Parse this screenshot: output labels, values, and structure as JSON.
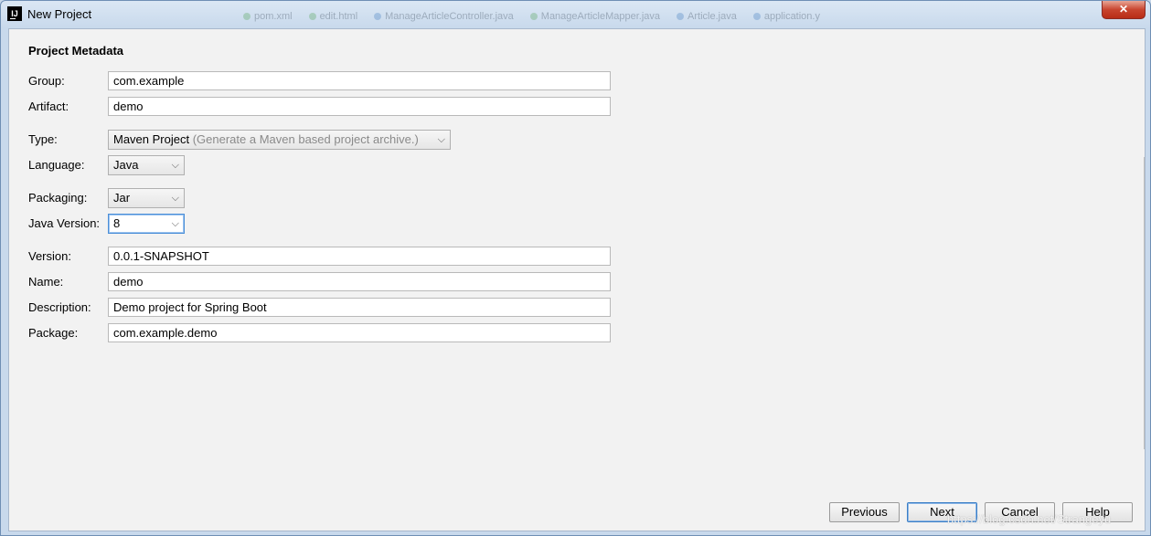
{
  "window": {
    "title": "New Project",
    "app_icon_text": "IJ",
    "close_symbol": "✕",
    "background_tabs": [
      "pom.xml",
      "edit.html",
      "ManageArticleController.java",
      "ManageArticleMapper.java",
      "Article.java",
      "application.y"
    ]
  },
  "section": {
    "title": "Project Metadata"
  },
  "form": {
    "group": {
      "label": "Group:",
      "value": "com.example"
    },
    "artifact": {
      "label": "Artifact:",
      "value": "demo"
    },
    "type": {
      "label": "Type:",
      "value": "Maven Project",
      "hint": "(Generate a Maven based project archive.)"
    },
    "language": {
      "label": "Language:",
      "value": "Java"
    },
    "packaging": {
      "label": "Packaging:",
      "value": "Jar"
    },
    "java_version": {
      "label": "Java Version:",
      "value": "8"
    },
    "version": {
      "label": "Version:",
      "value": "0.0.1-SNAPSHOT"
    },
    "name": {
      "label": "Name:",
      "value": "demo"
    },
    "description": {
      "label": "Description:",
      "value": "Demo project for Spring Boot"
    },
    "package": {
      "label": "Package:",
      "value": "com.example.demo"
    }
  },
  "buttons": {
    "previous": "Previous",
    "next": "Next",
    "cancel": "Cancel",
    "help": "Help"
  },
  "watermark": "https://blog.csdn.net/Strangeyu",
  "icons": {
    "dropdown": "chevron-down-icon",
    "close": "close-icon"
  },
  "colors": {
    "focus_border": "#4b8fd8",
    "close_button": "#c8452f"
  }
}
